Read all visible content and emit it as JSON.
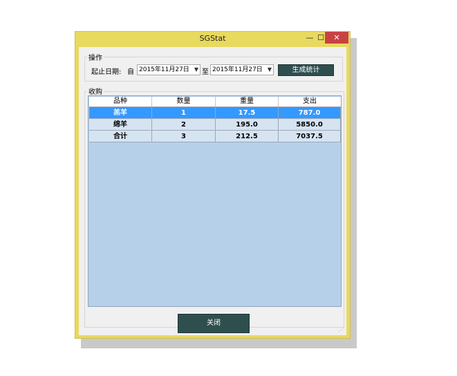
{
  "window": {
    "title": "SGStat",
    "minimize": "—",
    "maximize": "☐",
    "close": "✕"
  },
  "operation": {
    "group_label": "操作",
    "date_label": "起止日期:",
    "from_label": "自",
    "to_label": "至",
    "start_date": "2015年11月27日",
    "end_date": "2015年11月27日",
    "generate_button": "生成统计"
  },
  "purchase": {
    "group_label": "收购",
    "columns": [
      "品种",
      "数量",
      "重量",
      "支出"
    ],
    "rows": [
      [
        "羔羊",
        "1",
        "17.5",
        "787.0"
      ],
      [
        "绵羊",
        "2",
        "195.0",
        "5850.0"
      ],
      [
        "合计",
        "3",
        "212.5",
        "7037.5"
      ]
    ],
    "selected_row": 0
  },
  "footer": {
    "close_button": "关闭"
  },
  "colors": {
    "frame": "#e8d95f",
    "selected_row": "#3399ff",
    "grid_background": "#b7d0ea",
    "dark_button": "#2f4f4f",
    "close_button": "#c94242"
  }
}
